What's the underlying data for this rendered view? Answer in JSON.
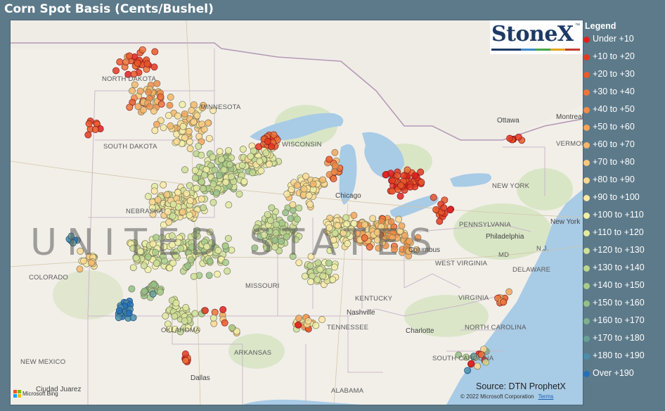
{
  "title": "Corn Spot Basis (Cents/Bushel)",
  "logo_text": "StoneX",
  "logo_tm": "™",
  "logo_bar_colors": [
    "#1d3a66",
    "#1d3a66",
    "#3a8cc8",
    "#48a548",
    "#e3a51f",
    "#c23b2a"
  ],
  "legend": {
    "title": "Legend",
    "items": [
      {
        "label": "Under +10",
        "color": "#e02020"
      },
      {
        "label": "+10 to +20",
        "color": "#e33a22"
      },
      {
        "label": "+20 to +30",
        "color": "#e85a2a"
      },
      {
        "label": "+30 to +40",
        "color": "#ec7438"
      },
      {
        "label": "+40 to +50",
        "color": "#f08c48"
      },
      {
        "label": "+50 to +60",
        "color": "#f4a45a"
      },
      {
        "label": "+60 to +70",
        "color": "#f6b76a"
      },
      {
        "label": "+70 to +80",
        "color": "#f8c87c"
      },
      {
        "label": "+80 to +90",
        "color": "#fad890"
      },
      {
        "label": "+90 to +100",
        "color": "#fce8a4"
      },
      {
        "label": "+100 to +110",
        "color": "#f2f0a8"
      },
      {
        "label": "+110 to +120",
        "color": "#e2eaa0"
      },
      {
        "label": "+120 to +130",
        "color": "#cfe098"
      },
      {
        "label": "+130 to +140",
        "color": "#bcd690"
      },
      {
        "label": "+140 to +150",
        "color": "#a8cc8a"
      },
      {
        "label": "+150 to +160",
        "color": "#94c088"
      },
      {
        "label": "+160 to +170",
        "color": "#7eb08e"
      },
      {
        "label": "+170 to +180",
        "color": "#68a096"
      },
      {
        "label": "+180 to +190",
        "color": "#4a8eac"
      },
      {
        "label": "Over +190",
        "color": "#2470b8"
      }
    ]
  },
  "map": {
    "watermark": "UNITED STATES",
    "state_labels": [
      "NORTH DAKOTA",
      "SOUTH DAKOTA",
      "MINNESOTA",
      "WISCONSIN",
      "NEBRASKA",
      "COLORADO",
      "MISSOURI",
      "KENTUCKY",
      "TENNESSEE",
      "OKLAHOMA",
      "ARKANSAS",
      "NEW MEXICO",
      "ALABAMA",
      "PENNSYLVANIA",
      "WEST VIRGINIA",
      "VIRGINIA",
      "NORTH CAROLINA",
      "SOUTH CAROLINA",
      "NEW YORK",
      "VERMONT",
      "MD",
      "N.J.",
      "DELAWARE"
    ],
    "city_labels": [
      "Chicago",
      "Columbus",
      "Nashville",
      "Charlotte",
      "Dallas",
      "Ottawa",
      "Montreal",
      "Philadelphia",
      "New York",
      "Ciudad Juarez"
    ]
  },
  "source": "Source: DTN ProphetX",
  "copyright": "© 2022 Microsoft Corporation",
  "terms": "Terms",
  "bing": "Microsoft Bing"
}
